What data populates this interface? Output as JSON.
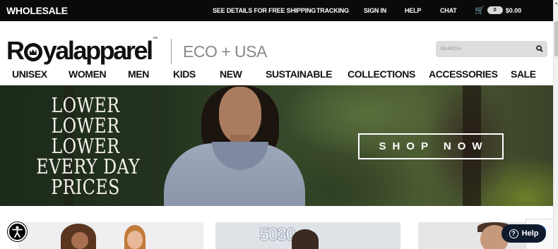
{
  "topbar": {
    "wholesale": "WHOLESALE",
    "links": [
      {
        "label": "SEE DETAILS FOR FREE SHIPPING"
      },
      {
        "label": "TRACKING"
      },
      {
        "label": "SIGN IN"
      },
      {
        "label": "HELP"
      },
      {
        "label": "CHAT"
      }
    ],
    "cart": {
      "count": "0",
      "total": "$0.00"
    }
  },
  "brand": {
    "logo_left": "R",
    "logo_right": "yalapparel",
    "trademark": "™",
    "tagline": "ECO + USA"
  },
  "search": {
    "placeholder": "SEARCH"
  },
  "nav": {
    "items": [
      {
        "label": "UNISEX"
      },
      {
        "label": "WOMEN"
      },
      {
        "label": "MEN"
      },
      {
        "label": "KIDS"
      },
      {
        "label": "NEW"
      },
      {
        "label": "SUSTAINABLE"
      },
      {
        "label": "COLLECTIONS"
      },
      {
        "label": "ACCESSORIES"
      },
      {
        "label": "SALE"
      }
    ]
  },
  "hero": {
    "lines": [
      "LOWER",
      "LOWER",
      "LOWER",
      "EVERY DAY",
      "PRICES"
    ],
    "cta": "SHOP NOW"
  },
  "card2": {
    "print": "5030"
  },
  "help": {
    "label": "Help"
  },
  "colors": {
    "topbar": "#0a0a0a",
    "help_bubble": "#0f1b2d",
    "search_bg": "#dddddd"
  }
}
